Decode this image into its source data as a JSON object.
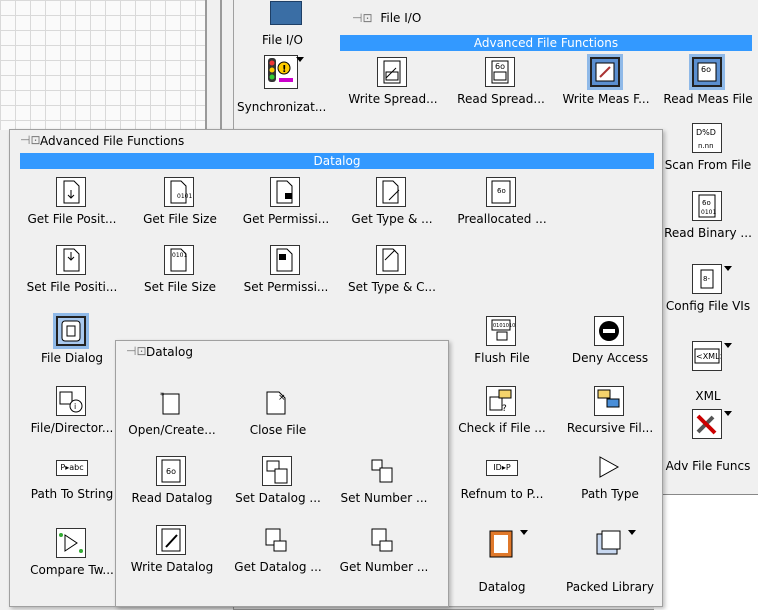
{
  "background_palette": {
    "left_labels": [
      "File I/O",
      "Synchronizat..."
    ],
    "title": "File I/O",
    "band": "Advanced File Functions",
    "row1": [
      "Write Spread...",
      "Read Spread...",
      "Write Meas F...",
      "Read Meas File"
    ],
    "right_column": [
      "Scan From File",
      "Read Binary ...",
      "Config File VIs",
      "XML",
      "Adv File Funcs"
    ]
  },
  "advanced_palette": {
    "title": "Advanced File Functions",
    "band": "Datalog",
    "row1": [
      "Get File Posit...",
      "Get File Size",
      "Get Permissi...",
      "Get Type & ...",
      "Preallocated ..."
    ],
    "row2": [
      "Set File Positi...",
      "Set File Size",
      "Set Permissi...",
      "Set Type & C..."
    ],
    "row3_left": [
      "File Dialog"
    ],
    "row3_right": [
      "Flush File",
      "Deny Access"
    ],
    "row4_left": [
      "File/Director..."
    ],
    "row4_right": [
      "Check if File ...",
      "Recursive Fil..."
    ],
    "row5_left": [
      "Path To String"
    ],
    "row5_right": [
      "Refnum to P...",
      "Path Type"
    ],
    "row6_left": [
      "Compare Tw..."
    ],
    "row6_right": [
      "Datalog",
      "Packed Library"
    ]
  },
  "datalog_palette": {
    "title": "Datalog",
    "row1": [
      "Open/Create...",
      "Close File"
    ],
    "row2": [
      "Read Datalog",
      "Set Datalog ...",
      "Set Number ..."
    ],
    "row3": [
      "Write Datalog",
      "Get Datalog ...",
      "Get Number ..."
    ]
  },
  "colors": {
    "selection": "#3399ff",
    "palette_bg": "#f0f0f0"
  }
}
